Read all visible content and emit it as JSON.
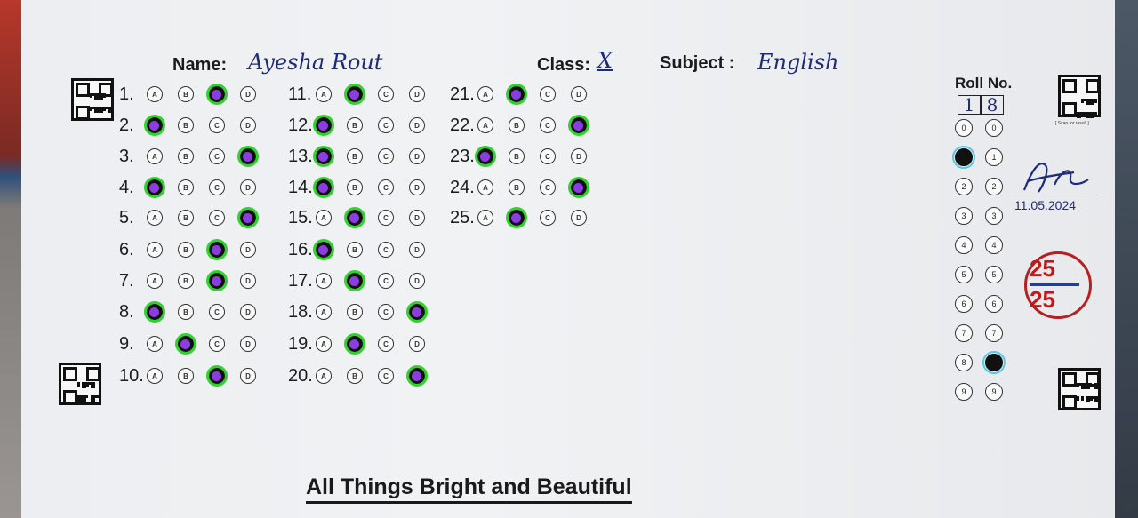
{
  "header": {
    "name_label": "Name:",
    "name_value": "Ayesha Rout",
    "class_label": "Class:",
    "class_value": "X",
    "subject_label": "Subject :",
    "subject_value": "English"
  },
  "answers": [
    {
      "q": "1.",
      "choice": "C"
    },
    {
      "q": "2.",
      "choice": "A"
    },
    {
      "q": "3.",
      "choice": "D"
    },
    {
      "q": "4.",
      "choice": "A"
    },
    {
      "q": "5.",
      "choice": "D"
    },
    {
      "q": "6.",
      "choice": "C"
    },
    {
      "q": "7.",
      "choice": "C"
    },
    {
      "q": "8.",
      "choice": "A"
    },
    {
      "q": "9.",
      "choice": "B"
    },
    {
      "q": "10.",
      "choice": "C"
    },
    {
      "q": "11.",
      "choice": "B"
    },
    {
      "q": "12.",
      "choice": "A"
    },
    {
      "q": "13.",
      "choice": "A"
    },
    {
      "q": "14.",
      "choice": "A"
    },
    {
      "q": "15.",
      "choice": "B"
    },
    {
      "q": "16.",
      "choice": "A"
    },
    {
      "q": "17.",
      "choice": "B"
    },
    {
      "q": "18.",
      "choice": "D"
    },
    {
      "q": "19.",
      "choice": "B"
    },
    {
      "q": "20.",
      "choice": "D"
    },
    {
      "q": "21.",
      "choice": "B"
    },
    {
      "q": "22.",
      "choice": "D"
    },
    {
      "q": "23.",
      "choice": "A"
    },
    {
      "q": "24.",
      "choice": "D"
    },
    {
      "q": "25.",
      "choice": "B"
    }
  ],
  "options": [
    "A",
    "B",
    "C",
    "D"
  ],
  "roll": {
    "label": "Roll No.",
    "digits": [
      "1",
      "8"
    ],
    "column_digits": [
      "0",
      "1",
      "2",
      "3",
      "4",
      "5",
      "6",
      "7",
      "8",
      "9"
    ]
  },
  "signature": {
    "date": "11.05.2024"
  },
  "score": {
    "obtained": "25",
    "total": "25"
  },
  "qr_caption": "[ Scan for result ]",
  "footer_title": "All Things Bright and Beautiful",
  "colors": {
    "correct_ring": "#2fd32c",
    "mark_dot": "#8a3ee0",
    "score_red": "#c21818",
    "ink_blue": "#1e2a7a"
  }
}
